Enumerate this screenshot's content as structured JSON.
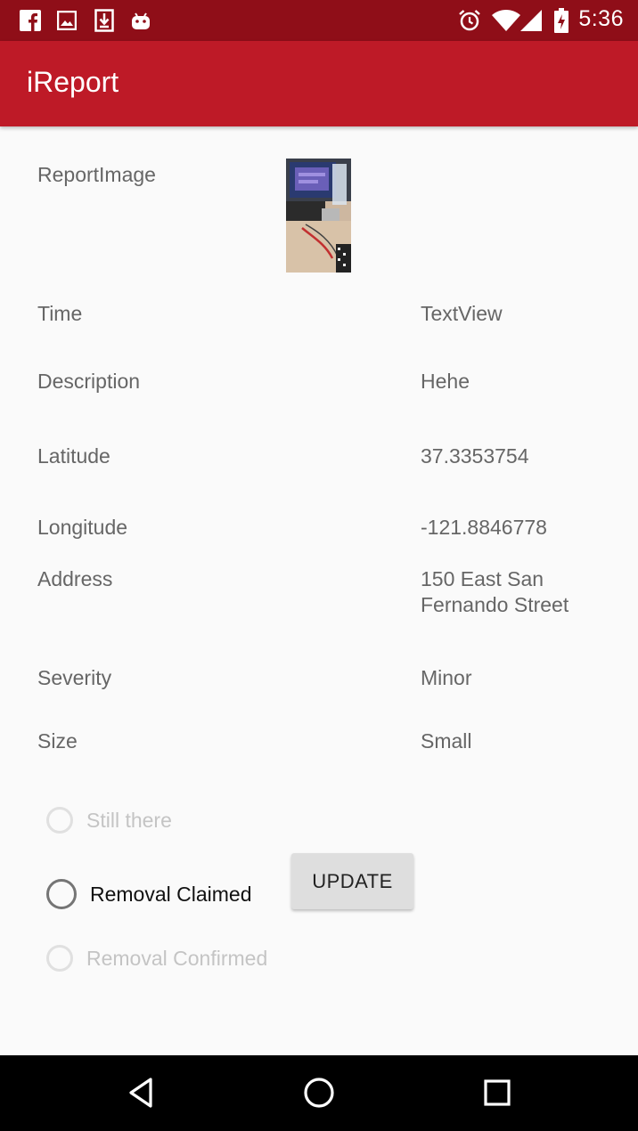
{
  "status_bar": {
    "time": "5:36",
    "icons": [
      "facebook-icon",
      "gallery-icon",
      "download-icon",
      "android-icon",
      "alarm-icon",
      "wifi-icon",
      "signal-icon",
      "battery-icon"
    ]
  },
  "app_bar": {
    "title": "iReport",
    "color": "#be1a27"
  },
  "report": {
    "image_label": "ReportImage",
    "rows": [
      {
        "label": "Time",
        "value": "TextView"
      },
      {
        "label": "Description",
        "value": "Hehe"
      },
      {
        "label": "Latitude",
        "value": "37.3353754"
      },
      {
        "label": "Longitude",
        "value": "-121.8846778"
      },
      {
        "label": "Address",
        "value_line1": "150 East San",
        "value_line2": "Fernando Street"
      },
      {
        "label": "Severity",
        "value": "Minor"
      },
      {
        "label": "Size",
        "value": "Small"
      }
    ]
  },
  "status_options": [
    {
      "label": "Still there",
      "enabled": false,
      "checked": false
    },
    {
      "label": "Removal Claimed",
      "enabled": true,
      "checked": false
    },
    {
      "label": "Removal Confirmed",
      "enabled": false,
      "checked": false
    }
  ],
  "update_button": {
    "label": "UPDATE"
  },
  "nav_bar": {
    "icons": [
      "back-icon",
      "home-icon",
      "recents-icon"
    ]
  }
}
